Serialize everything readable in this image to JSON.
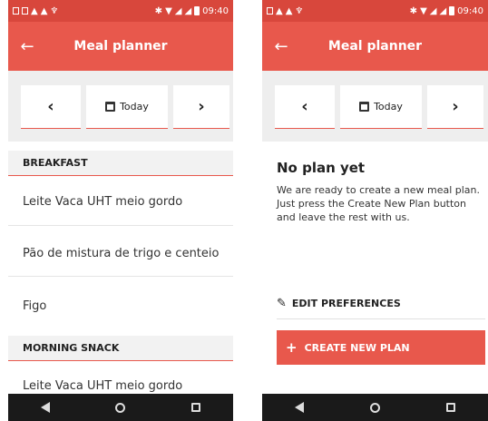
{
  "status": {
    "time": "09:40"
  },
  "colors": {
    "primary": "#e8584c",
    "status_bar": "#d8473c"
  },
  "app": {
    "title": "Meal planner",
    "back_icon": "arrow-left-icon"
  },
  "date_nav": {
    "today_label": "Today"
  },
  "left": {
    "sections": [
      {
        "header": "BREAKFAST",
        "items": [
          "Leite Vaca UHT meio gordo",
          "Pão de mistura de trigo e centeio",
          "Figo"
        ]
      },
      {
        "header": "MORNING SNACK",
        "items": [
          "Leite Vaca UHT meio gordo"
        ]
      }
    ]
  },
  "right": {
    "empty_title": "No plan yet",
    "empty_text": "We are ready to create a new meal plan. Just press the Create New Plan button and leave the rest with us.",
    "edit_label": "EDIT PREFERENCES",
    "create_label": "CREATE NEW PLAN"
  }
}
